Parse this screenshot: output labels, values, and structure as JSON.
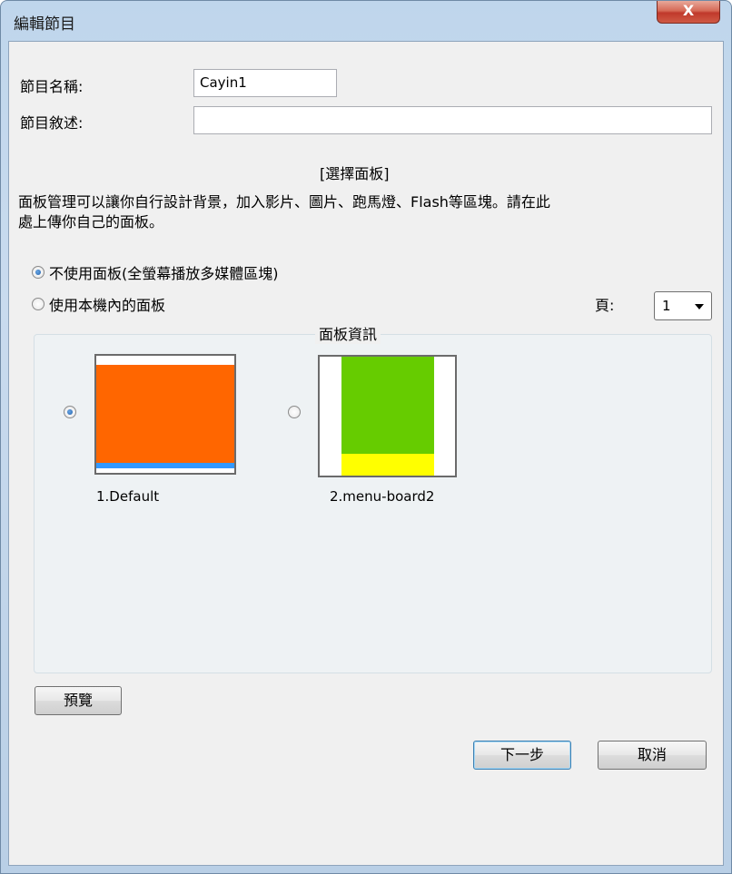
{
  "window": {
    "title": "編輯節目",
    "close_glyph": "X"
  },
  "form": {
    "name_label": "節目名稱:",
    "name_value": "Cayin1",
    "desc_label": "節目敘述:",
    "desc_value": ""
  },
  "panel_section": {
    "heading": "[選擇面板]",
    "description_line1": "面板管理可以讓你自行設計背景，加入影片、圖片、跑馬燈、Flash等區塊。請在此",
    "description_line2": "處上傳你自己的面板。",
    "option_no_panel": "不使用面板(全螢幕播放多媒體區塊)",
    "option_local_panel": "使用本機內的面板",
    "selected_option": "不使用面板(全螢幕播放多媒體區塊)",
    "page_label": "頁:",
    "page_value": "1"
  },
  "panel_info": {
    "legend": "面板資訊",
    "items": [
      {
        "label": "1.Default",
        "selected": true,
        "colors": {
          "main": "#ff6600",
          "bar": "#3399ff"
        }
      },
      {
        "label": "2.menu-board2",
        "selected": false,
        "colors": {
          "top": "#66cc00",
          "bottom": "#ffff00"
        }
      }
    ]
  },
  "buttons": {
    "preview": "預覽",
    "next": "下一步",
    "cancel": "取消"
  }
}
